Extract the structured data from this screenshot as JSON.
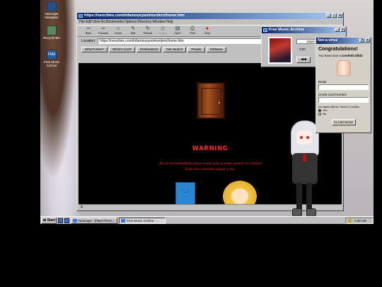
{
  "desktop_icons": [
    {
      "label": "Netscape Navigator"
    },
    {
      "label": "Recycle Bin"
    },
    {
      "label": "Free Music Archive"
    }
  ],
  "browser": {
    "title": "https://neocities.com/infamousyaoimurders/home.htm",
    "menu": [
      "File",
      "Edit",
      "View",
      "Go",
      "Bookmarks",
      "Options",
      "Directory",
      "Window",
      "Help"
    ],
    "toolbar": [
      {
        "label": "Back",
        "icon": "back-icon"
      },
      {
        "label": "Forward",
        "icon": "forward-icon"
      },
      {
        "label": "Home",
        "icon": "home-icon"
      },
      {
        "label": "Edit",
        "icon": "edit-icon"
      },
      {
        "label": "Reload",
        "icon": "reload-icon"
      },
      {
        "label": "Images",
        "icon": "images-icon"
      },
      {
        "label": "Open",
        "icon": "open-icon"
      },
      {
        "label": "Print",
        "icon": "print-icon"
      },
      {
        "label": "Stop",
        "icon": "stop-icon"
      }
    ],
    "location_label": "Location:",
    "location_url": "https://neocities.com/infamousyaoimurders/home.htm",
    "nav_buttons": [
      "What's New?",
      "What's Cool?",
      "Destinations",
      "Net Search",
      "People",
      "Software"
    ],
    "page": {
      "warning_title": "WARNING",
      "warning_line1": "¡No es recomendable entrar a este sitio si estas usando un celular!",
      "warning_line2": "Este sitio contiene sangre y eso"
    }
  },
  "music_player": {
    "title": "Free Music Archive",
    "status": "playing",
    "time": "0:00",
    "prev_symbol": "◀◀"
  },
  "popup": {
    "title": "Not a virus",
    "heading": "Congratulations!",
    "won_prefix": "You have won a",
    "won_item": "Confetti Dildo",
    "email_label": "Email",
    "card_label": "Credit Card Number",
    "terms": "you agree with the Terms & Conditio",
    "options": [
      "Yes",
      "No"
    ],
    "claim_button": "CLAIM NOW!"
  },
  "taskbar": {
    "start_label": "Start",
    "tasks": [
      "Netscape - [https://neoc...",
      "Free Music Archive - ..."
    ],
    "clock": "2:30 AM"
  },
  "colors": {
    "title_bar": "#0a246a",
    "warning_red": "#ff2a2a",
    "window_gray": "#c0c0c0"
  }
}
